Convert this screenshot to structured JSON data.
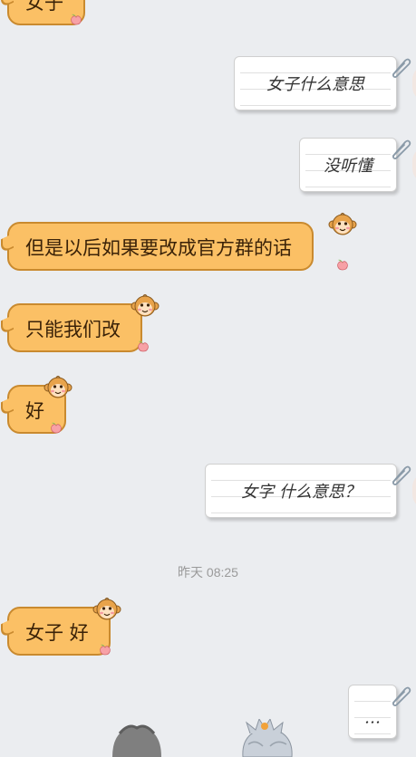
{
  "messages": [
    {
      "side": "in",
      "text": "女子"
    },
    {
      "side": "out",
      "text": "女子什么意思"
    },
    {
      "side": "out",
      "text": "没听懂"
    },
    {
      "side": "in",
      "text": "但是以后如果要改成官方群的话"
    },
    {
      "side": "in",
      "text": "只能我们改"
    },
    {
      "side": "in",
      "text": "好"
    },
    {
      "side": "out",
      "text": "女字 什么意思？"
    },
    {
      "side": "in",
      "text": "女子 好"
    },
    {
      "side": "out",
      "text": "…"
    }
  ],
  "timestamp": "昨天 08:25",
  "colors": {
    "background": "#ebedf0",
    "incoming_bubble": "#fbc065",
    "incoming_border": "#c98a2f",
    "outgoing_bubble": "#ffffff"
  }
}
